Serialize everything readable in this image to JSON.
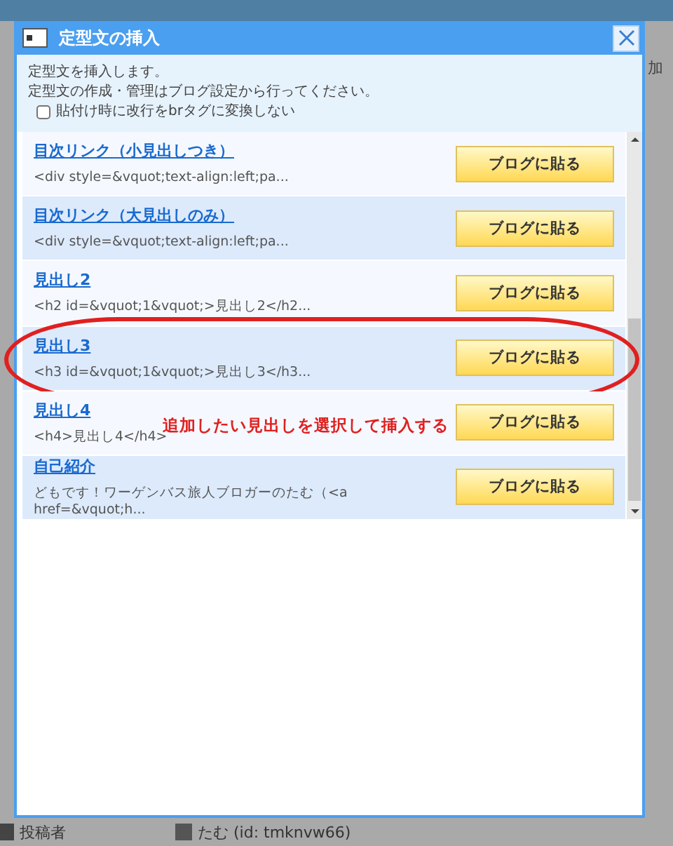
{
  "background": {
    "top_right_text": "加",
    "footer": [
      {
        "kind": "label",
        "text": "投稿者"
      },
      {
        "kind": "user",
        "text": "たむ (id: tmknvw66)"
      }
    ]
  },
  "dialog": {
    "title": "定型文の挿入",
    "info": [
      "定型文を挿入します。",
      "定型文の作成・管理はブログ設定から行ってください。"
    ],
    "option": {
      "label": "貼付け時に改行をbrタグに変換しない",
      "checked": false
    },
    "items": [
      {
        "title": "目次リンク（小見出しつき）",
        "snippet": "<div style=&vquot;text-align:left;pa...",
        "button": "ブログに貼る",
        "circled": false
      },
      {
        "title": "目次リンク（大見出しのみ）",
        "snippet": "<div style=&vquot;text-align:left;pa...",
        "button": "ブログに貼る",
        "circled": false
      },
      {
        "title": "見出し2",
        "snippet": "<h2 id=&vquot;1&vquot;>見出し2</h2...",
        "button": "ブログに貼る",
        "circled": false
      },
      {
        "title": "見出し3",
        "snippet": "<h3 id=&vquot;1&vquot;>見出し3</h3...",
        "button": "ブログに貼る",
        "circled": true
      },
      {
        "title": "見出し4",
        "snippet": "<h4>見出し4</h4>",
        "button": "ブログに貼る",
        "circled": false
      },
      {
        "title": "自己紹介",
        "snippet": "どもです！ワーゲンバス旅人ブロガーのたむ（<a href=&vquot;h...",
        "button": "ブログに貼る",
        "circled": false
      }
    ]
  },
  "annotation": {
    "text": "追加したい見出しを選択して挿入する",
    "color": "#e02020"
  }
}
